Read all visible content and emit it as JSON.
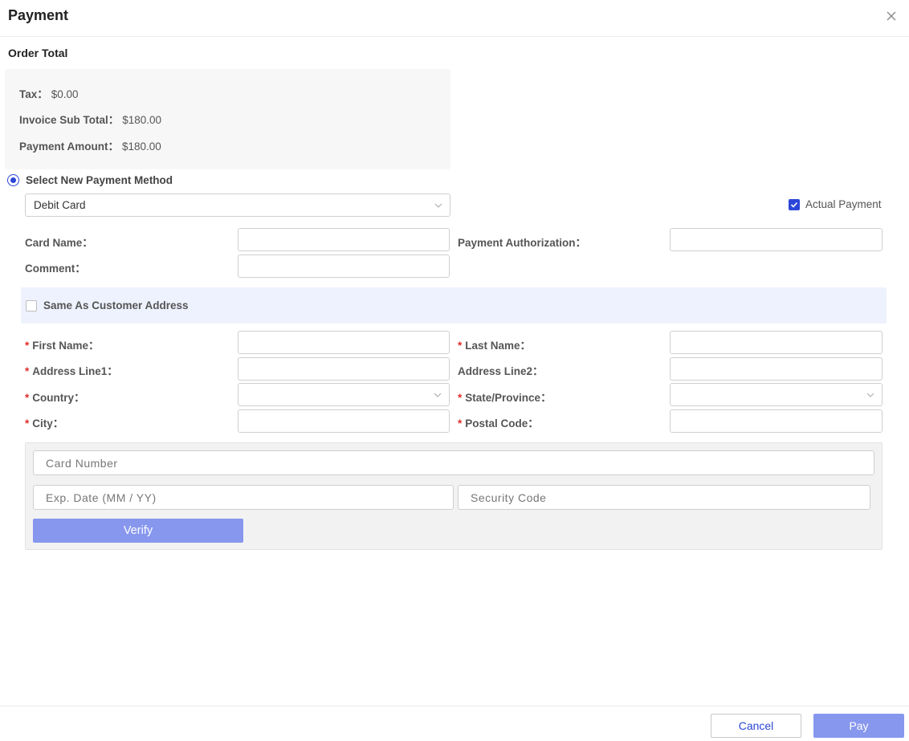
{
  "dialog": {
    "title": "Payment"
  },
  "order_total": {
    "title": "Order Total",
    "tax_label": "Tax",
    "tax_value": "$0.00",
    "sub_total_label": "Invoice Sub Total",
    "sub_total_value": "$180.00",
    "payment_amount_label": "Payment Amount",
    "payment_amount_value": "$180.00",
    "separator": "："
  },
  "payment_method": {
    "radio_label": "Select New Payment Method",
    "selected": "Debit Card",
    "actual_payment_label": "Actual Payment",
    "actual_payment_checked": true
  },
  "form": {
    "card_name_label": "Card Name",
    "payment_authorization_label": "Payment Authorization",
    "comment_label": "Comment",
    "same_as_customer_label": "Same As Customer Address",
    "first_name_label": "First Name",
    "last_name_label": "Last Name",
    "address_line1_label": "Address Line1",
    "address_line2_label": "Address Line2",
    "country_label": "Country",
    "state_label": "State/Province",
    "city_label": "City",
    "postal_code_label": "Postal Code",
    "colon": "：",
    "required_mark": "*"
  },
  "card": {
    "card_number_placeholder": "Card Number",
    "exp_date_placeholder": "Exp. Date (MM / YY)",
    "security_code_placeholder": "Security Code",
    "verify_label": "Verify"
  },
  "footer": {
    "cancel_label": "Cancel",
    "pay_label": "Pay"
  },
  "colors": {
    "accent": "#2b46d8",
    "button_fill": "#8797ee",
    "required": "#e02d2d",
    "band": "#eef2fe",
    "summary_bg": "#f7f7f7"
  },
  "icons": {
    "close": "close-icon",
    "chevron": "chevron-down-icon",
    "check": "check-icon"
  }
}
